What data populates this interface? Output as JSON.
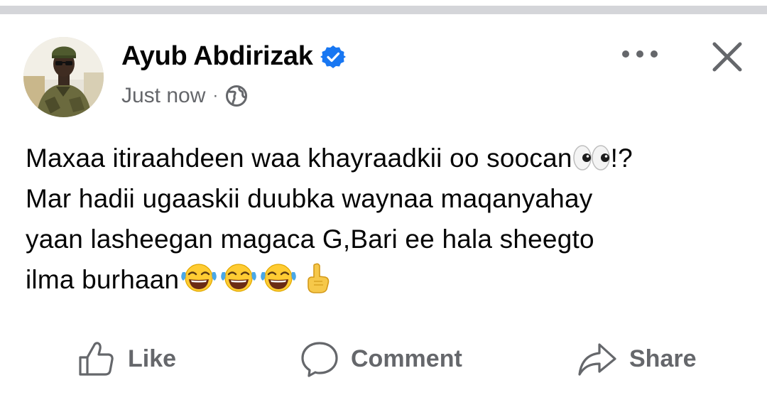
{
  "post": {
    "author": {
      "name": "Ayub Abdirizak",
      "verified": true
    },
    "timestamp": "Just now",
    "separator": "·",
    "audience_icon": "globe-icon",
    "text_lines": [
      "Maxaa itiraahdeen waa khayraadkii oo soocan",
      "Mar hadii ugaaskii duubka waynaa maqanyahay",
      "yaan lasheegan magaca G,Bari  ee hala sheegto",
      "ilma burhaan"
    ],
    "line1_tail": "!?",
    "actions": {
      "like": "Like",
      "comment": "Comment",
      "share": "Share"
    }
  },
  "colors": {
    "verified": "#1877f2",
    "secondary_text": "#65676b",
    "divider": "#d4d5d9"
  }
}
